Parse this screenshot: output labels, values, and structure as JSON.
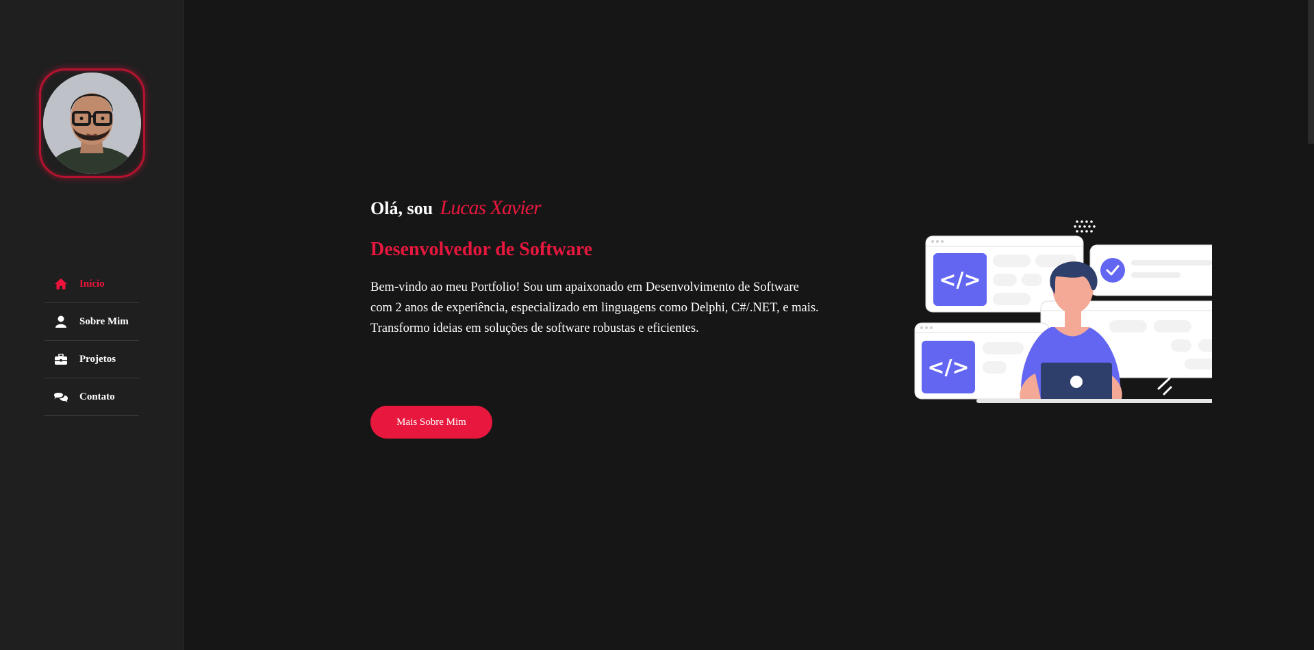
{
  "sidebar": {
    "nav": [
      {
        "label": "Início",
        "icon": "home-icon",
        "active": true
      },
      {
        "label": "Sobre Mim",
        "icon": "user-icon",
        "active": false
      },
      {
        "label": "Projetos",
        "icon": "briefcase-icon",
        "active": false
      },
      {
        "label": "Contato",
        "icon": "chat-icon",
        "active": false
      }
    ]
  },
  "hero": {
    "greeting": "Olá, sou",
    "name": "Lucas Xavier",
    "role": "Desenvolvedor de Software",
    "description": "Bem-vindo ao meu Portfolio! Sou um apaixonado em Desenvolvimento de Software com 2 anos de experiência, especializado em linguagens como Delphi, C#/.NET, e mais. Transformo ideias em soluções de software robustas e eficientes.",
    "button_label": "Mais Sobre Mim"
  },
  "colors": {
    "accent": "#e8173e",
    "background": "#161616",
    "sidebar": "#1f1f1f",
    "illustration_purple": "#6366f1"
  }
}
